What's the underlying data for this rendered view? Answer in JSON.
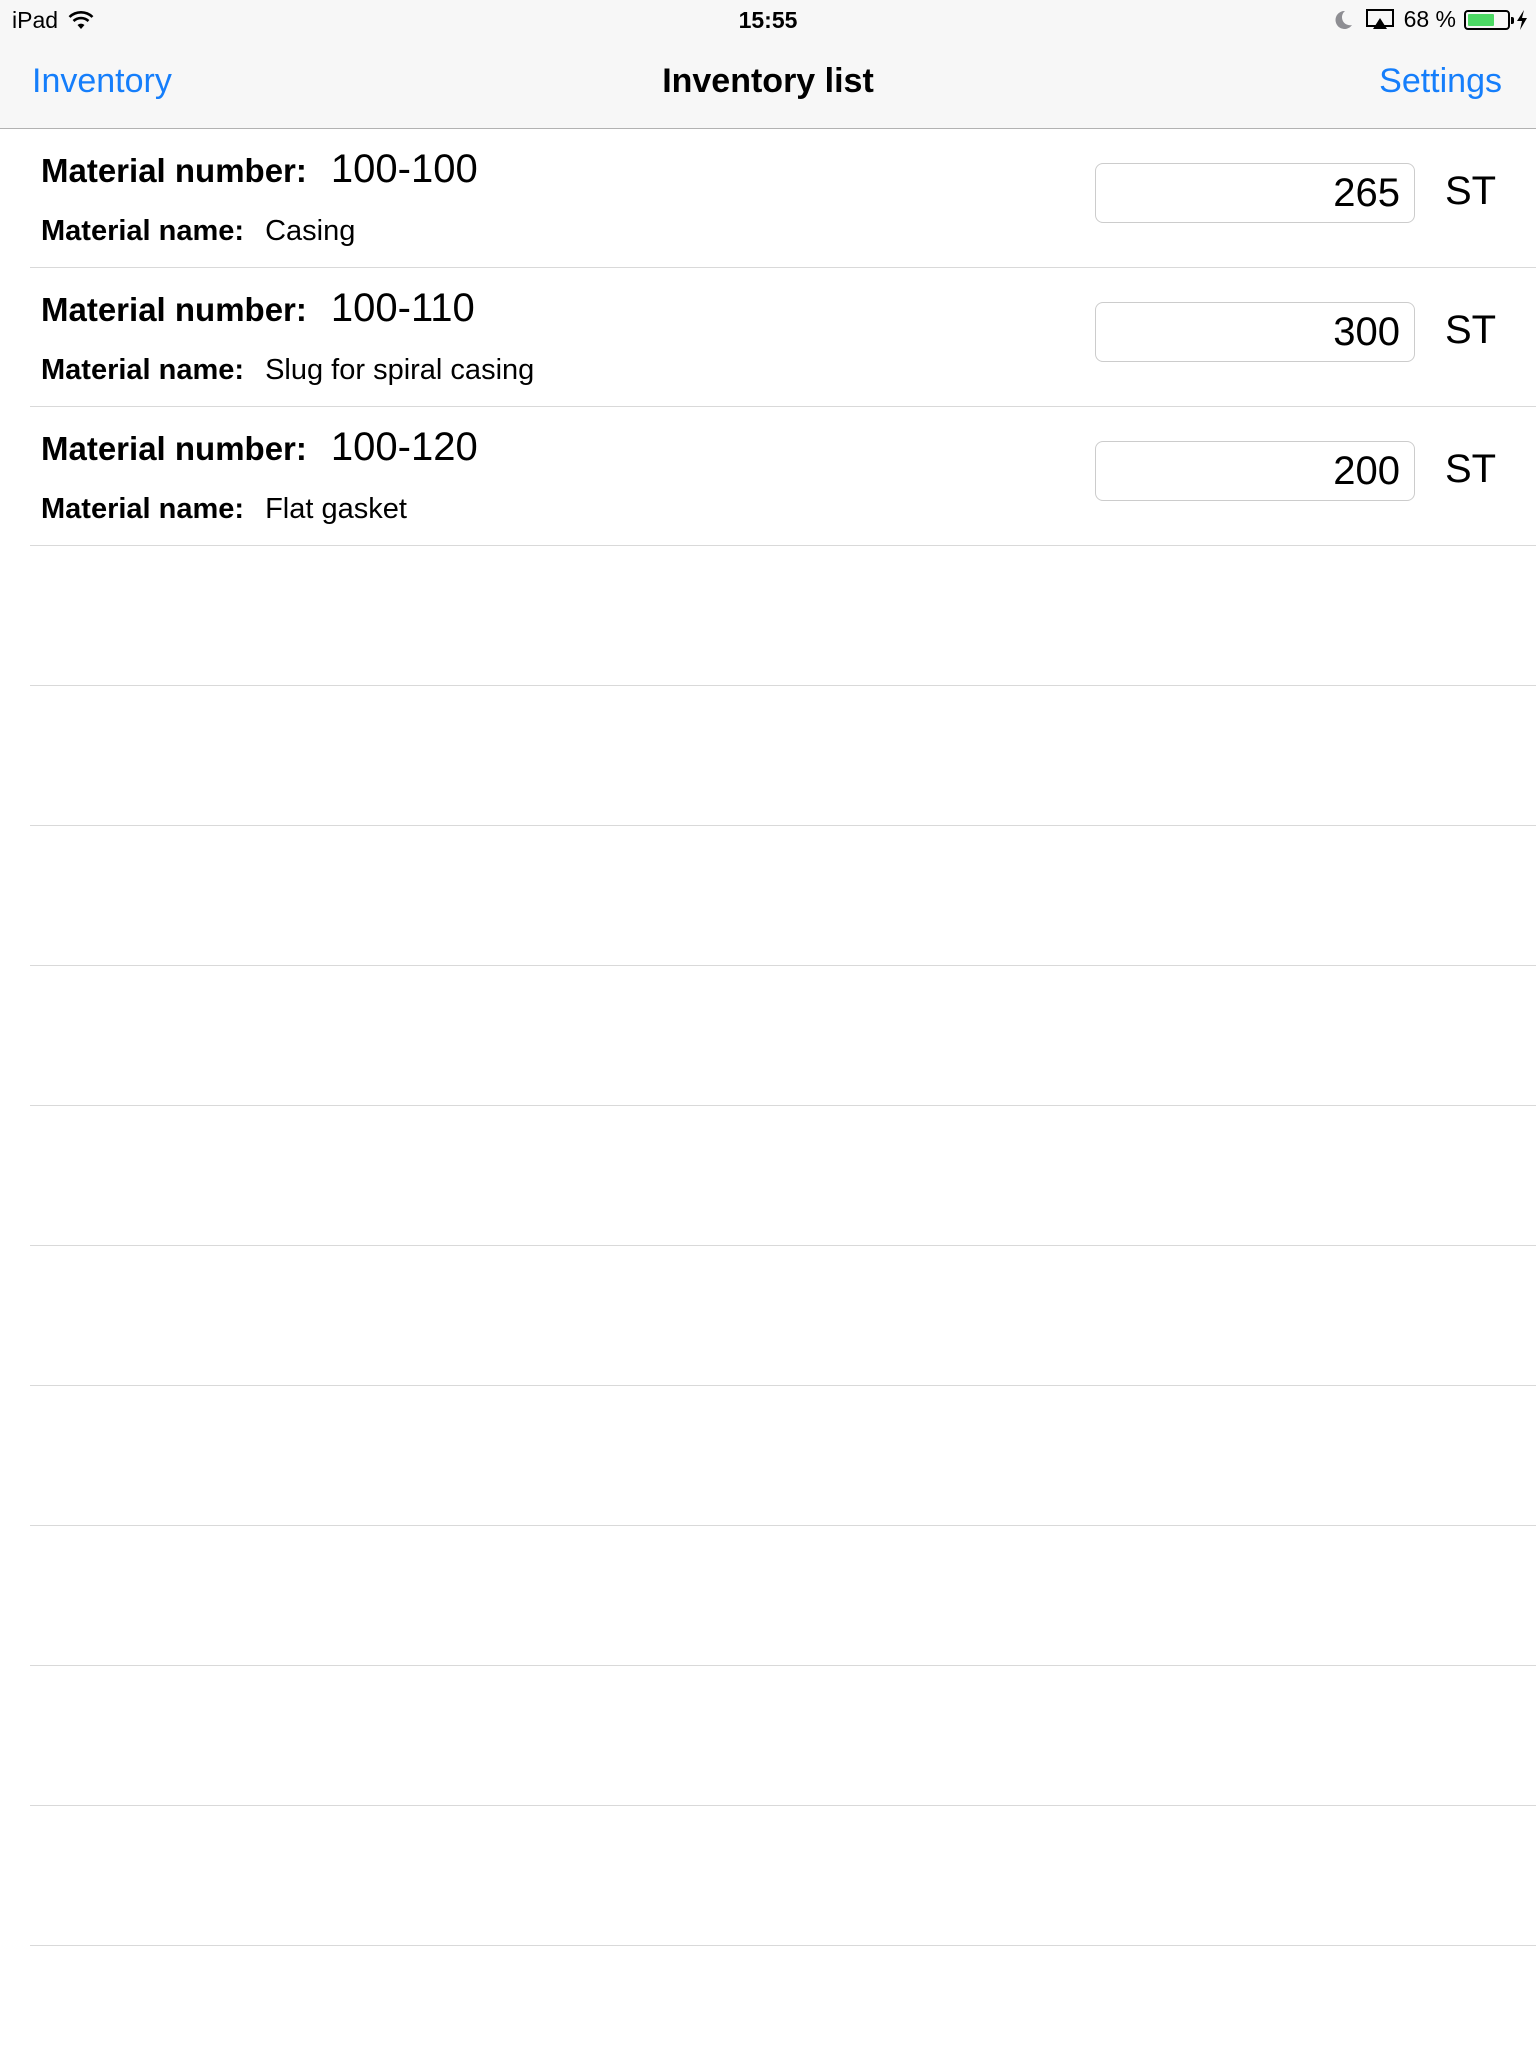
{
  "status_bar": {
    "device": "iPad",
    "time": "15:55",
    "battery_percent_text": "68 %",
    "battery_level": 0.68,
    "battery_color": "#4cd964",
    "icons": [
      "wifi-icon",
      "moon-icon",
      "airplay-icon",
      "battery-icon",
      "charging-bolt-icon"
    ]
  },
  "nav": {
    "back_label": "Inventory",
    "title": "Inventory list",
    "settings_label": "Settings",
    "accent_color": "#157efb"
  },
  "labels": {
    "material_number": "Material number:",
    "material_name": "Material name:"
  },
  "items": [
    {
      "number": "100-100",
      "name": "Casing",
      "quantity": "265",
      "unit": "ST"
    },
    {
      "number": "100-110",
      "name": "Slug for spiral casing",
      "quantity": "300",
      "unit": "ST"
    },
    {
      "number": "100-120",
      "name": "Flat gasket",
      "quantity": "200",
      "unit": "ST"
    }
  ]
}
